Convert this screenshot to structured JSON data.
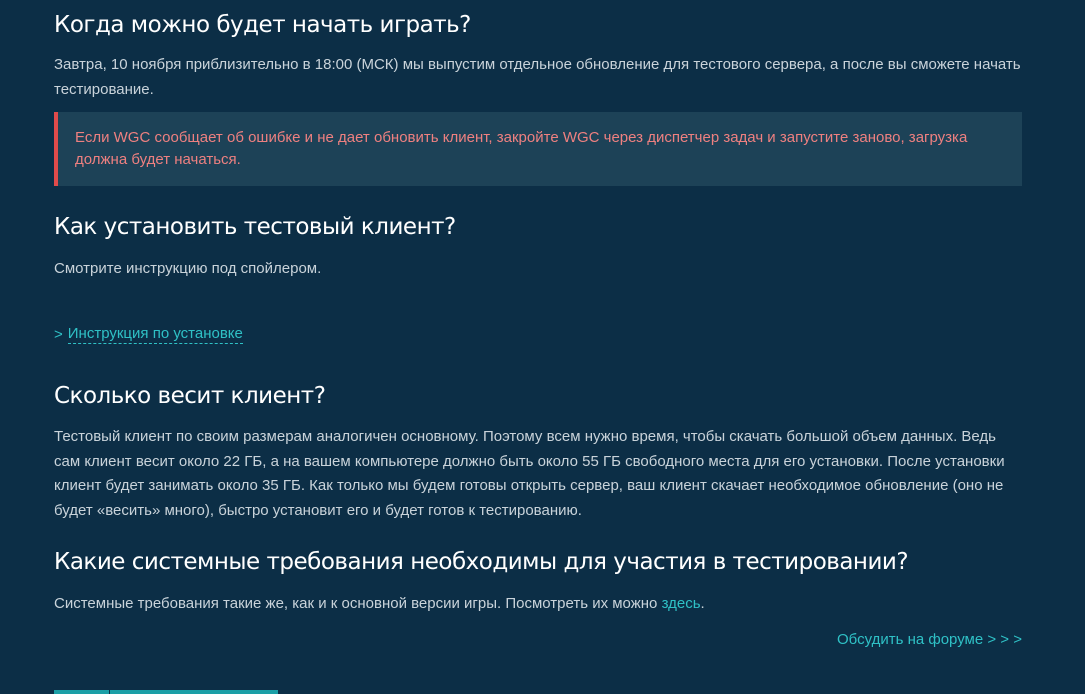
{
  "sections": {
    "start": {
      "title": "Когда можно будет начать играть?",
      "text": "Завтра, 10 ноября приблизительно в 18:00 (МСК) мы выпустим отдельное обновление для тестового сервера, а после вы сможете начать тестирование."
    },
    "alert": {
      "text": "Если WGC сообщает об ошибке и не дает обновить клиент, закройте WGC через диспетчер задач и запустите заново, загрузка должна будет начаться."
    },
    "install": {
      "title": "Как установить тестовый клиент?",
      "text": "Смотрите инструкцию под спойлером.",
      "spoiler_arrow": ">",
      "spoiler_label": "Инструкция по установке"
    },
    "size": {
      "title": "Сколько весит клиент?",
      "text": "Тестовый клиент по своим размерам аналогичен основному. Поэтому всем нужно время, чтобы скачать большой объем данных. Ведь сам клиент весит около 22 ГБ, а на вашем компьютере должно быть около 55 ГБ свободного места для его установки. После установки клиент будет занимать около 35 ГБ. Как только мы будем готовы открыть сервер, ваш клиент скачает необходимое обновление (оно не будет «весить» много), быстро установит его и будет готов к тестированию."
    },
    "requirements": {
      "title": "Какие системные требования необходимы для участия в тестировании?",
      "text_before": "Системные требования такие же, как и к основной версии игры. Посмотреть их можно ",
      "link_label": "здесь",
      "text_after": "."
    }
  },
  "forum_link": "Обсудить на форуме > > >",
  "colors": {
    "background": "#0c2e46",
    "heading": "#ffffff",
    "body_text": "#c9d3da",
    "accent": "#2fc1c6",
    "alert_bg": "#1d4257",
    "alert_border": "#e14b4b",
    "alert_text": "#ee8080"
  }
}
